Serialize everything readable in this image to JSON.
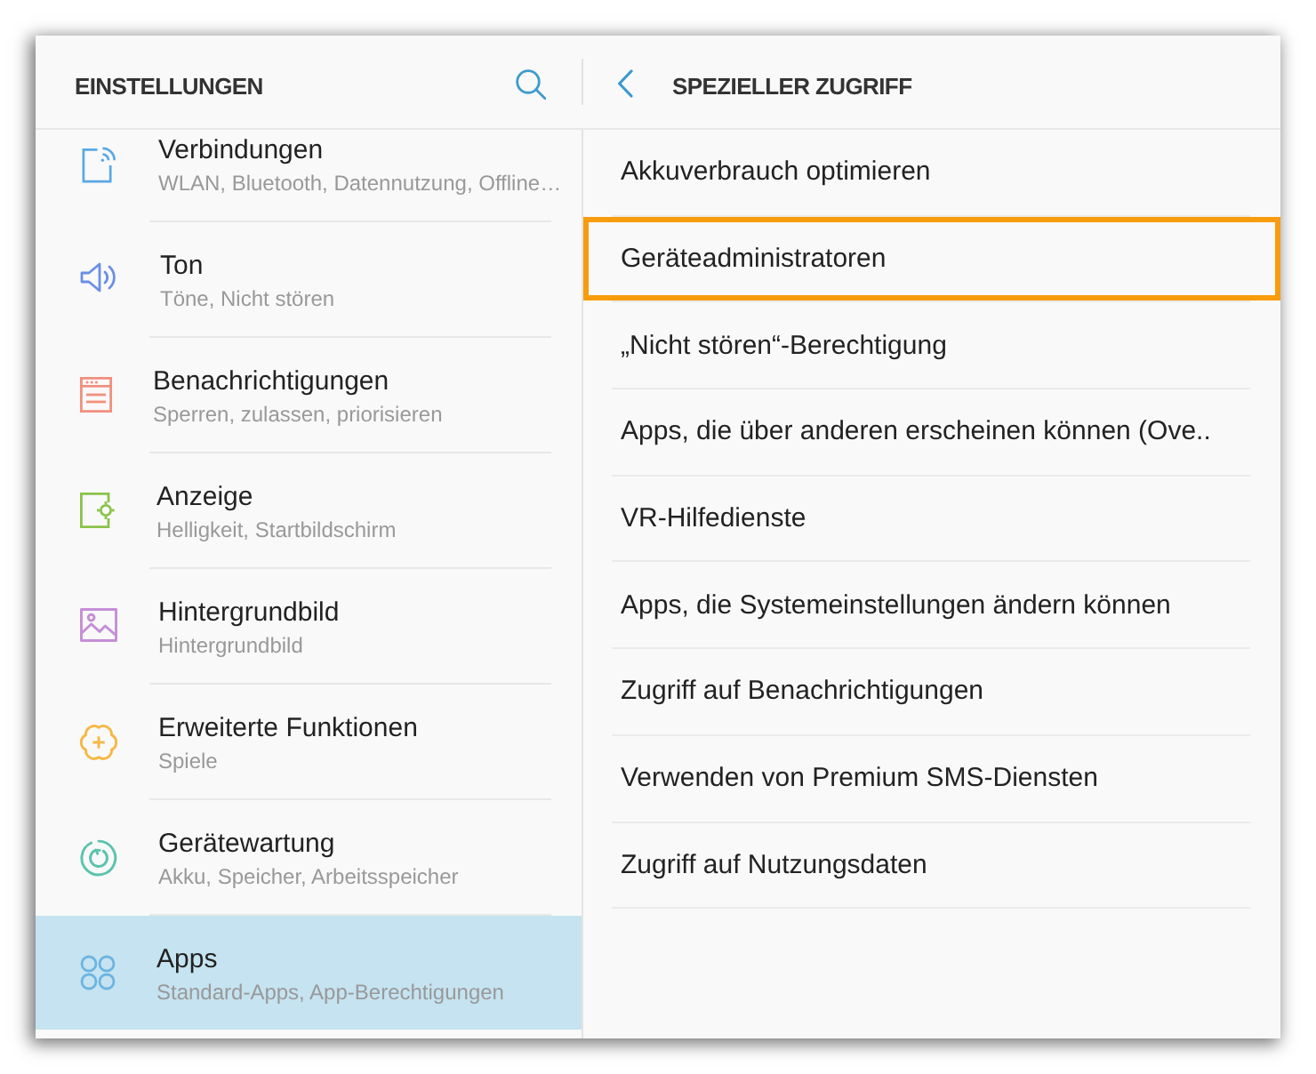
{
  "sidebar": {
    "title": "EINSTELLUNGEN",
    "items": [
      {
        "title": "Verbindungen",
        "subtitle": "WLAN, Bluetooth, Datennutzung, Offline…",
        "color": "#5aa9e6",
        "selected": false
      },
      {
        "title": "Ton",
        "subtitle": "Töne, Nicht stören",
        "color": "#6b8fe6",
        "selected": false
      },
      {
        "title": "Benachrichtigungen",
        "subtitle": "Sperren, zulassen, priorisieren",
        "color": "#f2907e",
        "selected": false
      },
      {
        "title": "Anzeige",
        "subtitle": "Helligkeit, Startbildschirm",
        "color": "#8bc34a",
        "selected": false
      },
      {
        "title": "Hintergrundbild",
        "subtitle": "Hintergrundbild",
        "color": "#c58fd6",
        "selected": false
      },
      {
        "title": "Erweiterte Funktionen",
        "subtitle": "Spiele",
        "color": "#f6b846",
        "selected": false
      },
      {
        "title": "Gerätewartung",
        "subtitle": "Akku, Speicher, Arbeitsspeicher",
        "color": "#5cc3ad",
        "selected": false
      },
      {
        "title": "Apps",
        "subtitle": "Standard-Apps, App-Berechtigungen",
        "color": "#6cb4e2",
        "selected": true
      }
    ]
  },
  "panel": {
    "title": "SPEZIELLER ZUGRIFF",
    "items": [
      {
        "label": "Akkuverbrauch optimieren",
        "highlighted": false
      },
      {
        "label": "Geräteadministratoren",
        "highlighted": true
      },
      {
        "label": "„Nicht stören“-Berechtigung",
        "highlighted": false
      },
      {
        "label": "Apps, die über anderen erscheinen können (Ove..",
        "highlighted": false
      },
      {
        "label": "VR-Hilfedienste",
        "highlighted": false
      },
      {
        "label": "Apps, die Systemeinstellungen ändern können",
        "highlighted": false
      },
      {
        "label": "Zugriff auf Benachrichtigungen",
        "highlighted": false
      },
      {
        "label": "Verwenden von Premium SMS-Diensten",
        "highlighted": false
      },
      {
        "label": "Zugriff auf Nutzungsdaten",
        "highlighted": false
      }
    ]
  }
}
